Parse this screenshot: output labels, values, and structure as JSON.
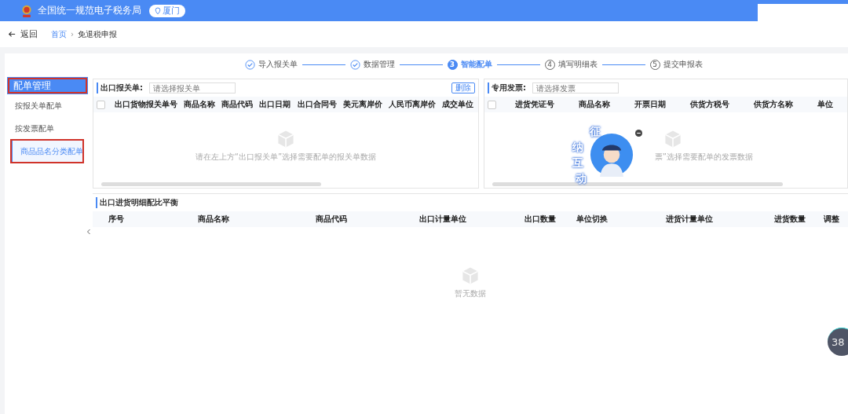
{
  "header": {
    "title": "全国统一规范电子税务局",
    "location": "厦门"
  },
  "nav": {
    "back": "返回",
    "separator": "›",
    "breadcrumb": [
      {
        "label": "首页",
        "link": true
      },
      {
        "label": "免退税申报",
        "link": false
      }
    ]
  },
  "steps": [
    {
      "label": "导入报关单",
      "completed": true,
      "selected": false
    },
    {
      "label": "数据管理",
      "completed": true,
      "selected": false
    },
    {
      "number": "3",
      "label": "智能配单",
      "completed": false,
      "selected": true
    },
    {
      "number": "4",
      "label": "填写明细表",
      "completed": false,
      "selected": false
    },
    {
      "number": "5",
      "label": "提交申报表",
      "completed": false,
      "selected": false
    }
  ],
  "sidebar": {
    "title": "配单管理",
    "title_annotated": true,
    "items": [
      {
        "label": "按报关单配单",
        "selected": false,
        "annotated": false
      },
      {
        "label": "按发票配单",
        "selected": false,
        "annotated": false
      },
      {
        "label": "商品品名分类配单",
        "selected": true,
        "annotated": true
      }
    ]
  },
  "customs_panel": {
    "label": "出口报关单:",
    "select_all_checked": false,
    "placeholder": "请选择报关单",
    "button": "删除",
    "columns": [
      "出口货物报关单号",
      "商品名称",
      "商品代码",
      "出口日期",
      "出口合同号",
      "美元离岸价",
      "人民币离岸价",
      "成交单位"
    ],
    "empty_text": "请在左上方“出口报关单”选择需要配单的报关单数据"
  },
  "invoice_panel": {
    "label": "专用发票:",
    "select_all_checked": false,
    "placeholder": "请选择发票",
    "columns": [
      "进货凭证号",
      "商品名称",
      "开票日期",
      "供货方税号",
      "供货方名称",
      "单位"
    ],
    "empty_text": "票”选择需要配单的发票数据"
  },
  "detail_panel": {
    "title": "出口进货明细配比平衡",
    "columns": [
      "序号",
      "商品名称",
      "商品代码",
      "出口计量单位",
      "出口数量",
      "单位切换",
      "进货计量单位",
      "进货数量",
      "调整"
    ],
    "empty_text": "暂无数据"
  },
  "assistant": {
    "chars": [
      "征",
      "纳",
      "互",
      "动"
    ]
  },
  "progress_badge": {
    "value": "38"
  }
}
